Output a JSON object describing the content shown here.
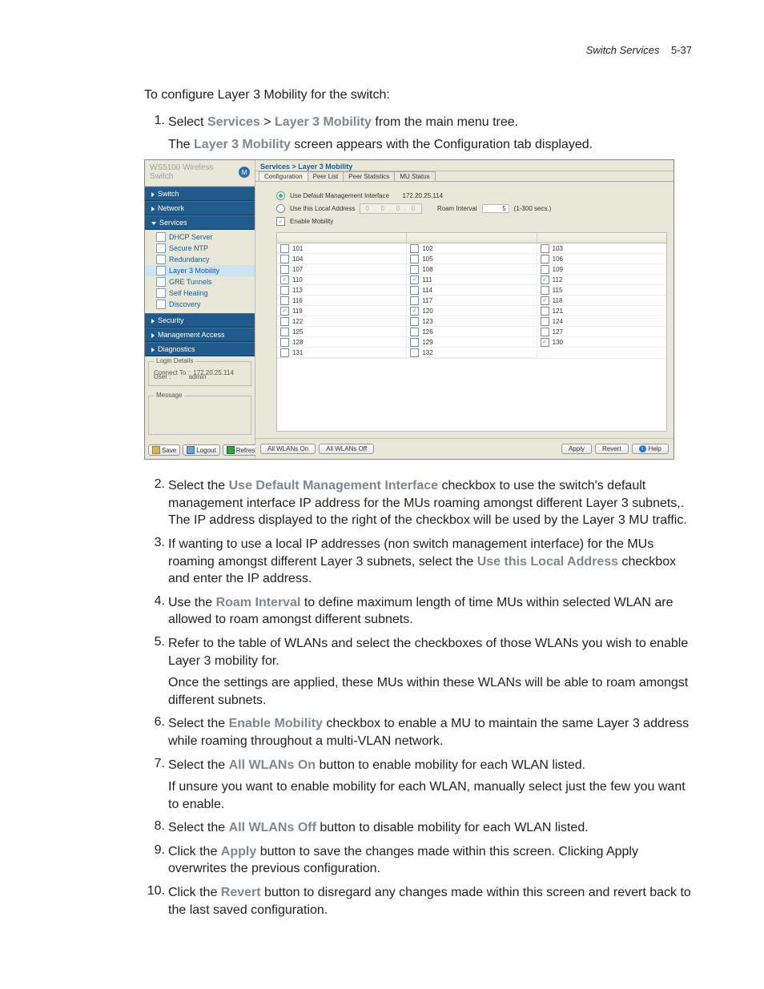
{
  "header": {
    "section": "Switch Services",
    "page": "5-37"
  },
  "intro": "To configure Layer 3 Mobility for the switch:",
  "step1": {
    "text_a": "Select ",
    "b1": "Services",
    "gt": " > ",
    "b2": "Layer 3 Mobility",
    "text_b": " from the main menu tree.",
    "para_a": "The ",
    "para_b": "Layer 3 Mobility",
    "para_c": " screen appears with the Configuration tab displayed."
  },
  "step2": {
    "a": "Select the ",
    "b": "Use Default Management Interface",
    "c": " checkbox to use the switch's default management interface IP address for the MUs roaming amongst different Layer 3 subnets,. The IP address displayed to the right of the checkbox will be used by the Layer 3 MU traffic."
  },
  "step3": {
    "a": "If wanting to use a local IP addresses (non switch management interface) for the MUs roaming amongst different Layer 3 subnets, select the ",
    "b": "Use this Local Address",
    "c": " checkbox and enter the IP address."
  },
  "step4": {
    "a": "Use the ",
    "b": "Roam Interval",
    "c": " to define maximum length of time MUs within selected WLAN are allowed to roam amongst different subnets."
  },
  "step5": {
    "a": "Refer to the table of WLANs and select the checkboxes of those WLANs you wish to enable Layer 3 mobility for.",
    "p": "Once the settings are applied, these MUs within these WLANs will be able to roam amongst different subnets."
  },
  "step6": {
    "a": "Select the ",
    "b": "Enable Mobility",
    "c": " checkbox to enable a MU to maintain the same Layer 3 address while roaming throughout a multi-VLAN network."
  },
  "step7": {
    "a": "Select the ",
    "b": "All WLANs On",
    "c": " button to enable mobility for each WLAN listed.",
    "p": "If unsure you want to enable mobility for each WLAN, manually select just the few you want to enable."
  },
  "step8": {
    "a": "Select the ",
    "b": "All WLANs Off",
    "c": " button to disable mobility for each WLAN listed."
  },
  "step9": {
    "a": "Click the ",
    "b": "Apply",
    "c": " button to save the changes made within this screen. Clicking Apply overwrites the previous configuration."
  },
  "step10": {
    "a": "Click the ",
    "b": "Revert",
    "c": " button to disregard any changes made within this screen and revert back to the last saved configuration."
  },
  "nums": {
    "n1": "1.",
    "n2": "2.",
    "n3": "3.",
    "n4": "4.",
    "n5": "5.",
    "n6": "6.",
    "n7": "7.",
    "n8": "8.",
    "n9": "9.",
    "n10": "10."
  },
  "win": {
    "brand": "WS5100 Wireless Switch",
    "nav": {
      "switch": "Switch",
      "network": "Network",
      "services": "Services",
      "security": "Security",
      "mgmt": "Management Access",
      "diag": "Diagnostics",
      "sub": {
        "dhcp": "DHCP Server",
        "ntp": "Secure NTP",
        "redun": "Redundancy",
        "l3": "Layer 3 Mobility",
        "gre": "GRE Tunnels",
        "self": "Self Healing",
        "disc": "Discovery"
      }
    },
    "login": {
      "title": "Login Details",
      "connect_lbl": "Connect To :",
      "connect_val": "172.20.25.114",
      "user_lbl": "User :",
      "user_val": "admin"
    },
    "msg_title": "Message",
    "footer_btns": {
      "save": "Save",
      "logout": "Logout",
      "refresh": "Refresh"
    },
    "crumb": "Services > Layer 3 Mobility",
    "tabs": {
      "config": "Configuration",
      "peer": "Peer List",
      "stats": "Peer Statistics",
      "mu": "MU Status"
    },
    "opts": {
      "default_mgmt": "Use Default Management Interface",
      "default_ip": "172.20.25.114",
      "local_addr": "Use this Local Address",
      "local_ip": "0  .  0  .  0  .  0",
      "roam_lbl": "Roam Interval",
      "roam_val": "5",
      "roam_range": "(1-300 secs.)",
      "enable": "Enable Mobility"
    },
    "grid": {
      "col1": [
        {
          "v": "101",
          "c": false
        },
        {
          "v": "104",
          "c": false
        },
        {
          "v": "107",
          "c": false
        },
        {
          "v": "110",
          "c": true
        },
        {
          "v": "113",
          "c": false
        },
        {
          "v": "116",
          "c": false
        },
        {
          "v": "119",
          "c": true
        },
        {
          "v": "122",
          "c": false
        },
        {
          "v": "125",
          "c": false
        },
        {
          "v": "128",
          "c": false
        },
        {
          "v": "131",
          "c": false
        }
      ],
      "col2": [
        {
          "v": "102",
          "c": false
        },
        {
          "v": "105",
          "c": false
        },
        {
          "v": "108",
          "c": false
        },
        {
          "v": "111",
          "c": true
        },
        {
          "v": "114",
          "c": false
        },
        {
          "v": "117",
          "c": false
        },
        {
          "v": "120",
          "c": true
        },
        {
          "v": "123",
          "c": false
        },
        {
          "v": "126",
          "c": false
        },
        {
          "v": "129",
          "c": false
        },
        {
          "v": "132",
          "c": false
        }
      ],
      "col3": [
        {
          "v": "103",
          "c": false
        },
        {
          "v": "106",
          "c": false
        },
        {
          "v": "109",
          "c": false
        },
        {
          "v": "112",
          "c": true
        },
        {
          "v": "115",
          "c": false
        },
        {
          "v": "118",
          "c": true
        },
        {
          "v": "121",
          "c": false
        },
        {
          "v": "124",
          "c": false
        },
        {
          "v": "127",
          "c": false
        },
        {
          "v": "130",
          "c": true
        }
      ]
    },
    "cfoot": {
      "all_on": "All WLANs On",
      "all_off": "All WLANs Off",
      "apply": "Apply",
      "revert": "Revert",
      "help": "Help"
    }
  }
}
